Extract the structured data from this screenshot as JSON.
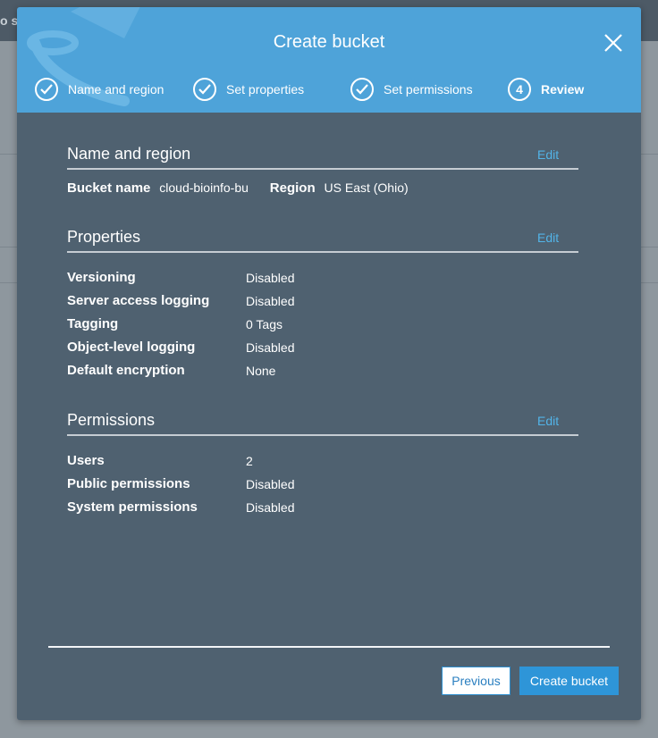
{
  "background": {
    "topbar_fragment": "o s"
  },
  "modal": {
    "title": "Create bucket",
    "steps": [
      {
        "label": "Name and region",
        "status": "complete"
      },
      {
        "label": "Set properties",
        "status": "complete"
      },
      {
        "label": "Set permissions",
        "status": "complete"
      },
      {
        "label": "Review",
        "number": "4",
        "status": "active"
      }
    ],
    "sections": {
      "name_region": {
        "title": "Name and region",
        "edit": "Edit",
        "bucket_name_label": "Bucket name",
        "bucket_name_value": "cloud-bioinfo-bu",
        "region_label": "Region",
        "region_value": "US East (Ohio)"
      },
      "properties": {
        "title": "Properties",
        "edit": "Edit",
        "rows": [
          {
            "label": "Versioning",
            "value": "Disabled"
          },
          {
            "label": "Server access logging",
            "value": "Disabled"
          },
          {
            "label": "Tagging",
            "value": "0 Tags"
          },
          {
            "label": "Object-level logging",
            "value": "Disabled"
          },
          {
            "label": "Default encryption",
            "value": "None"
          }
        ]
      },
      "permissions": {
        "title": "Permissions",
        "edit": "Edit",
        "rows": [
          {
            "label": "Users",
            "value": "2"
          },
          {
            "label": "Public permissions",
            "value": "Disabled"
          },
          {
            "label": "System permissions",
            "value": "Disabled"
          }
        ]
      }
    },
    "footer": {
      "previous_label": "Previous",
      "create_label": "Create bucket"
    },
    "colors": {
      "header": "#4ea3d9",
      "body": "#4f6170",
      "link": "#52b4e8",
      "primary_button": "#2e95d8"
    }
  }
}
